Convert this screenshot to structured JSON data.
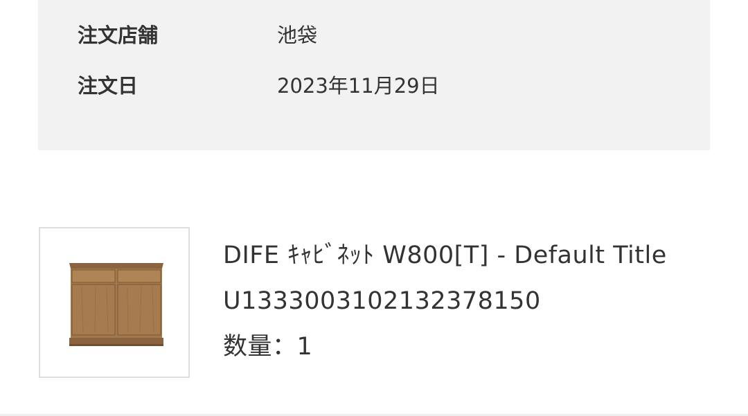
{
  "order": {
    "store_label": "注文店舗",
    "store_value": "池袋",
    "date_label": "注文日",
    "date_value": "2023年11月29日"
  },
  "product": {
    "image_icon": "cabinet-product-image",
    "name": "DIFE ｷｬﾋﾞﾈｯﾄ W800[T] - Default Title",
    "sku": "U1333003102132378150",
    "quantity": "数量：1"
  },
  "colors": {
    "panel_bg": "#f2f2f2",
    "text": "#333333",
    "thumb_border": "#dedede",
    "wood": "#a2784c"
  }
}
